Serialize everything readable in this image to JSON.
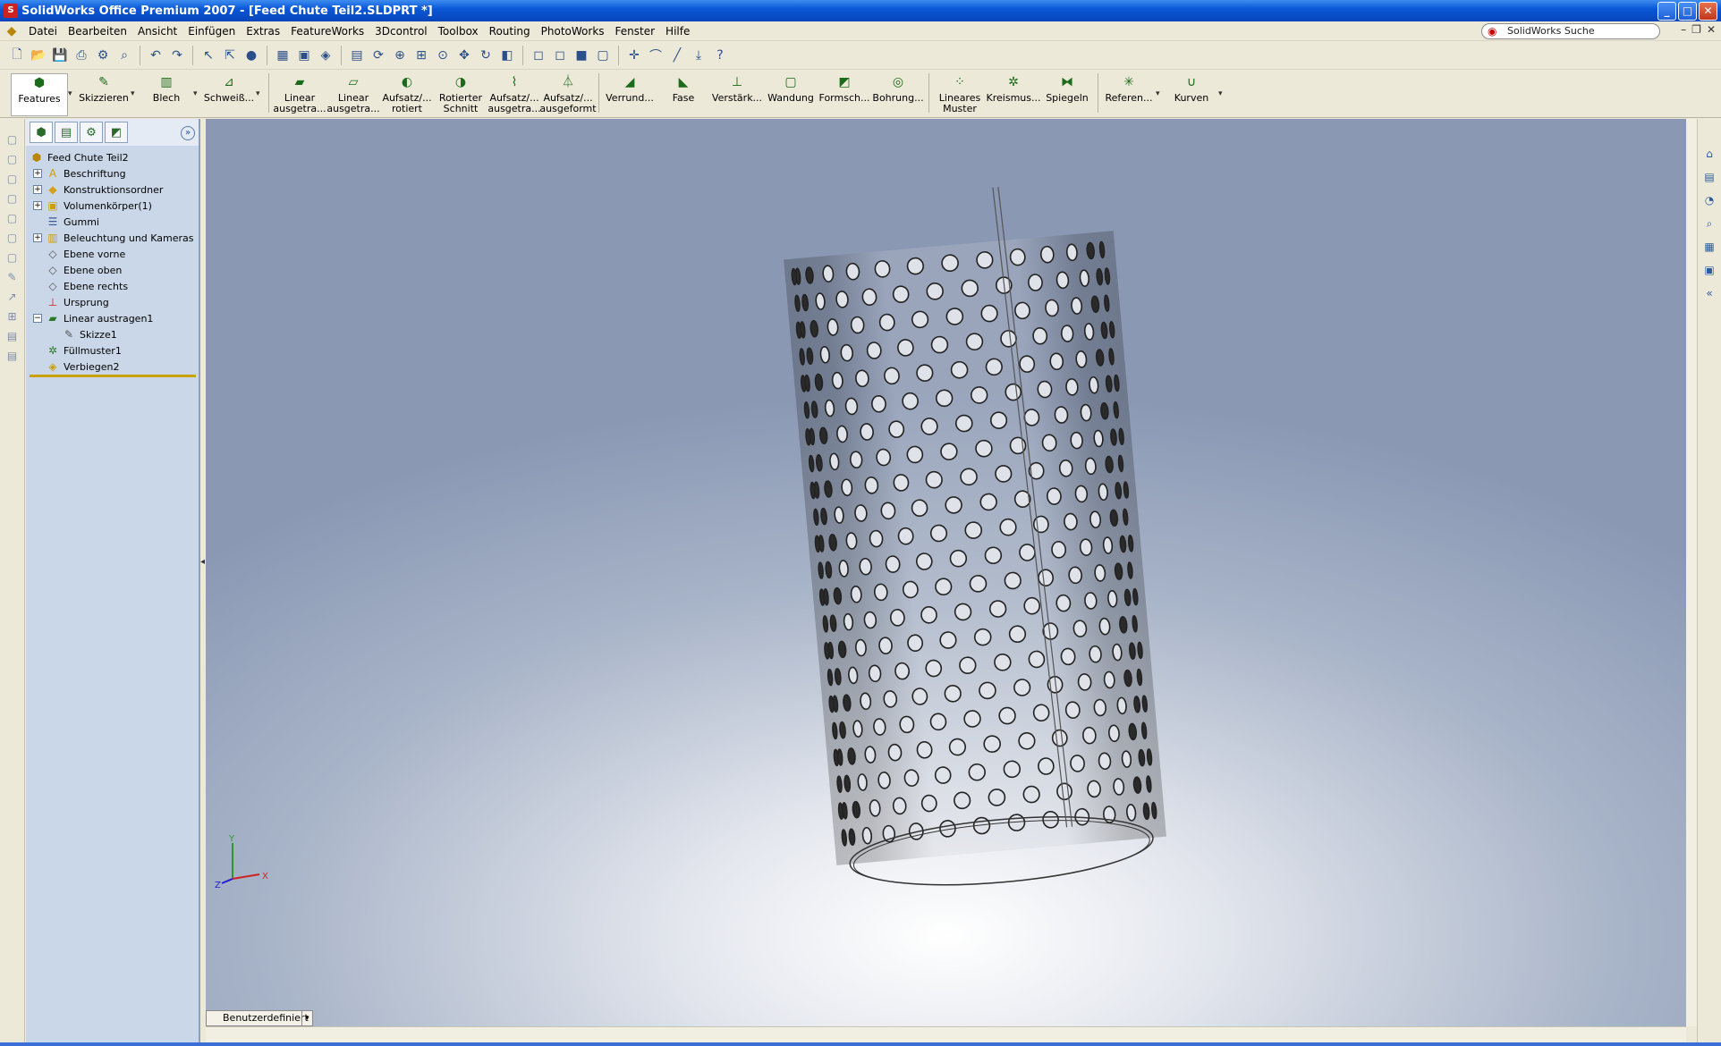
{
  "window": {
    "title": "SolidWorks Office Premium 2007 - [Feed Chute Teil2.SLDPRT *]",
    "buttons": [
      "minimize",
      "maximize",
      "close"
    ]
  },
  "menubar": {
    "items": [
      "Datei",
      "Bearbeiten",
      "Ansicht",
      "Einfügen",
      "Extras",
      "FeatureWorks",
      "3Dcontrol",
      "Toolbox",
      "Routing",
      "PhotoWorks",
      "Fenster",
      "Hilfe"
    ],
    "search_label": "SolidWorks Suche"
  },
  "toolbar": {
    "icons": [
      "new-file-icon",
      "open-file-icon",
      "save-icon",
      "print-icon",
      "options-icon",
      "print-preview-icon",
      "undo-icon",
      "redo-icon",
      "select-icon",
      "select-filter-icon",
      "rebuild-icon",
      "grid-icon",
      "display-style-icon",
      "appearance-icon",
      "view-orientation-icon",
      "rotate-icon",
      "zoom-fit-icon",
      "zoom-area-icon",
      "zoom-in-icon",
      "pan-icon",
      "rotate-view-icon",
      "section-view-icon",
      "standard-views-icon",
      "isometric-icon",
      "trimetric-icon",
      "shaded-icon",
      "wireframe-icon",
      "hidden-lines-icon",
      "point-icon",
      "arc-icon",
      "line-icon",
      "split-icon",
      "help-icon"
    ]
  },
  "command_manager": {
    "tabs": [
      {
        "label": "Features"
      },
      {
        "label": "Skizzieren"
      },
      {
        "label": "Blech"
      },
      {
        "label": "Schweiß..."
      }
    ],
    "commands": [
      {
        "label": "Linear ausgetra..."
      },
      {
        "label": "Linear ausgetra..."
      },
      {
        "label": "Aufsatz/... rotiert"
      },
      {
        "label": "Rotierter Schnitt"
      },
      {
        "label": "Aufsatz/... ausgetra..."
      },
      {
        "label": "Aufsatz/... ausgeformt"
      },
      {
        "label": "Verrund..."
      },
      {
        "label": "Fase"
      },
      {
        "label": "Verstärk..."
      },
      {
        "label": "Wandung"
      },
      {
        "label": "Formsch..."
      },
      {
        "label": "Bohrung..."
      },
      {
        "label": "Lineares Muster"
      },
      {
        "label": "Kreismus..."
      },
      {
        "label": "Spiegeln"
      },
      {
        "label": "Referen..."
      },
      {
        "label": "Kurven"
      }
    ]
  },
  "feature_tree": {
    "root": "Feed Chute Teil2",
    "items": [
      {
        "label": "Beschriftung",
        "expand": "+"
      },
      {
        "label": "Konstruktionsordner",
        "expand": "+"
      },
      {
        "label": "Volumenkörper(1)",
        "expand": "+"
      },
      {
        "label": "Gummi",
        "expand": ""
      },
      {
        "label": "Beleuchtung und Kameras",
        "expand": "+"
      },
      {
        "label": "Ebene vorne",
        "expand": ""
      },
      {
        "label": "Ebene oben",
        "expand": ""
      },
      {
        "label": "Ebene rechts",
        "expand": ""
      },
      {
        "label": "Ursprung",
        "expand": ""
      },
      {
        "label": "Linear austragen1",
        "expand": "−"
      },
      {
        "label": "Skizze1",
        "expand": ""
      },
      {
        "label": "Füllmuster1",
        "expand": ""
      },
      {
        "label": "Verbiegen2",
        "expand": ""
      }
    ]
  },
  "viewport": {
    "view_name": "Benutzerdefiniert",
    "triad_labels": {
      "x": "X",
      "y": "Y",
      "z": "Z"
    }
  },
  "colors": {
    "titlebar": "#0a58d8",
    "tree_bg": "#cad7e8",
    "rollback_bar": "#c9a100"
  }
}
